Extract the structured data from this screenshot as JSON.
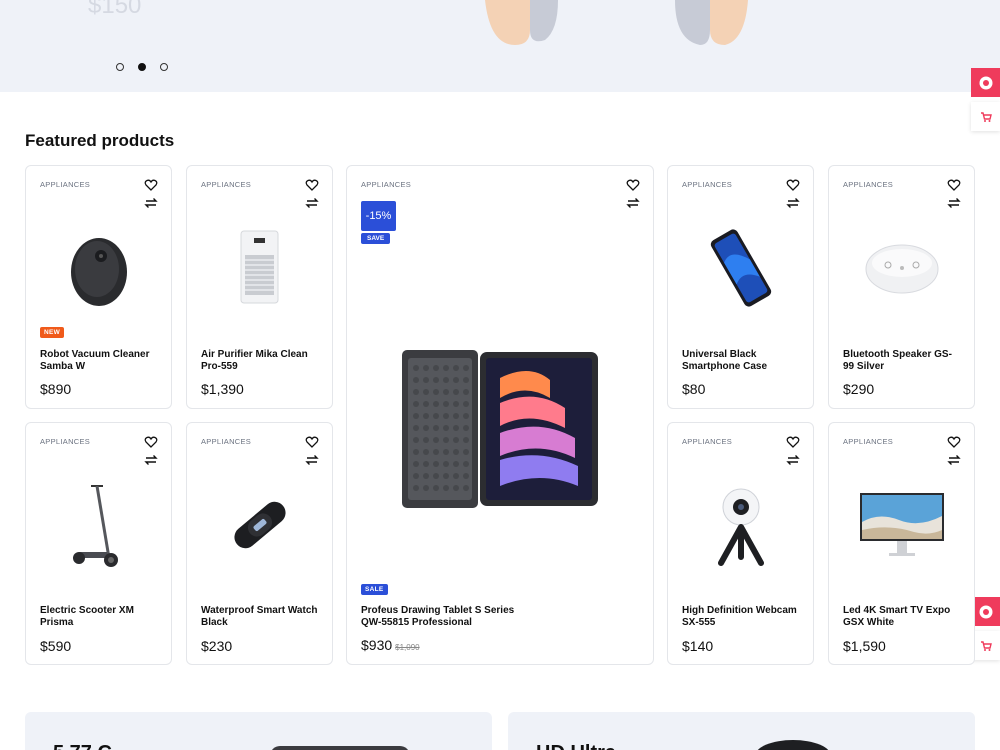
{
  "hero": {
    "price": "$150",
    "dots": [
      false,
      true,
      false
    ]
  },
  "section": {
    "title": "Featured products"
  },
  "products": [
    {
      "category": "APPLIANCES",
      "name": "Robot Vacuum Cleaner Samba W",
      "price": "$890",
      "badge": "NEW"
    },
    {
      "category": "APPLIANCES",
      "name": "Air Purifier Mika Clean Pro-559",
      "price": "$1,390"
    },
    {
      "category": "APPLIANCES",
      "name": "Profeus Drawing Tablet S Series QW-55815 Professional",
      "price": "$930",
      "old_price": "$1,090",
      "discount": "-15%",
      "save_label": "SAVE",
      "badge": "SALE"
    },
    {
      "category": "APPLIANCES",
      "name": "Universal Black Smartphone Case",
      "price": "$80"
    },
    {
      "category": "APPLIANCES",
      "name": "Bluetooth Speaker GS-99 Silver",
      "price": "$290"
    },
    {
      "category": "APPLIANCES",
      "name": "Electric Scooter XM Prisma",
      "price": "$590"
    },
    {
      "category": "APPLIANCES",
      "name": "Waterproof Smart Watch Black",
      "price": "$230"
    },
    {
      "category": "APPLIANCES",
      "name": "High Definition Webcam SX-555",
      "price": "$140"
    },
    {
      "category": "APPLIANCES",
      "name": "Led 4K Smart TV Expo GSX White",
      "price": "$1,590"
    }
  ],
  "promos": [
    {
      "text": "5.77 C"
    },
    {
      "text": "HD Ultra"
    }
  ],
  "colors": {
    "accent": "#2b4fd8",
    "new_badge": "#f05a1a",
    "side_widget": "#ef3b5c",
    "hero_bg": "#eff2f8"
  }
}
